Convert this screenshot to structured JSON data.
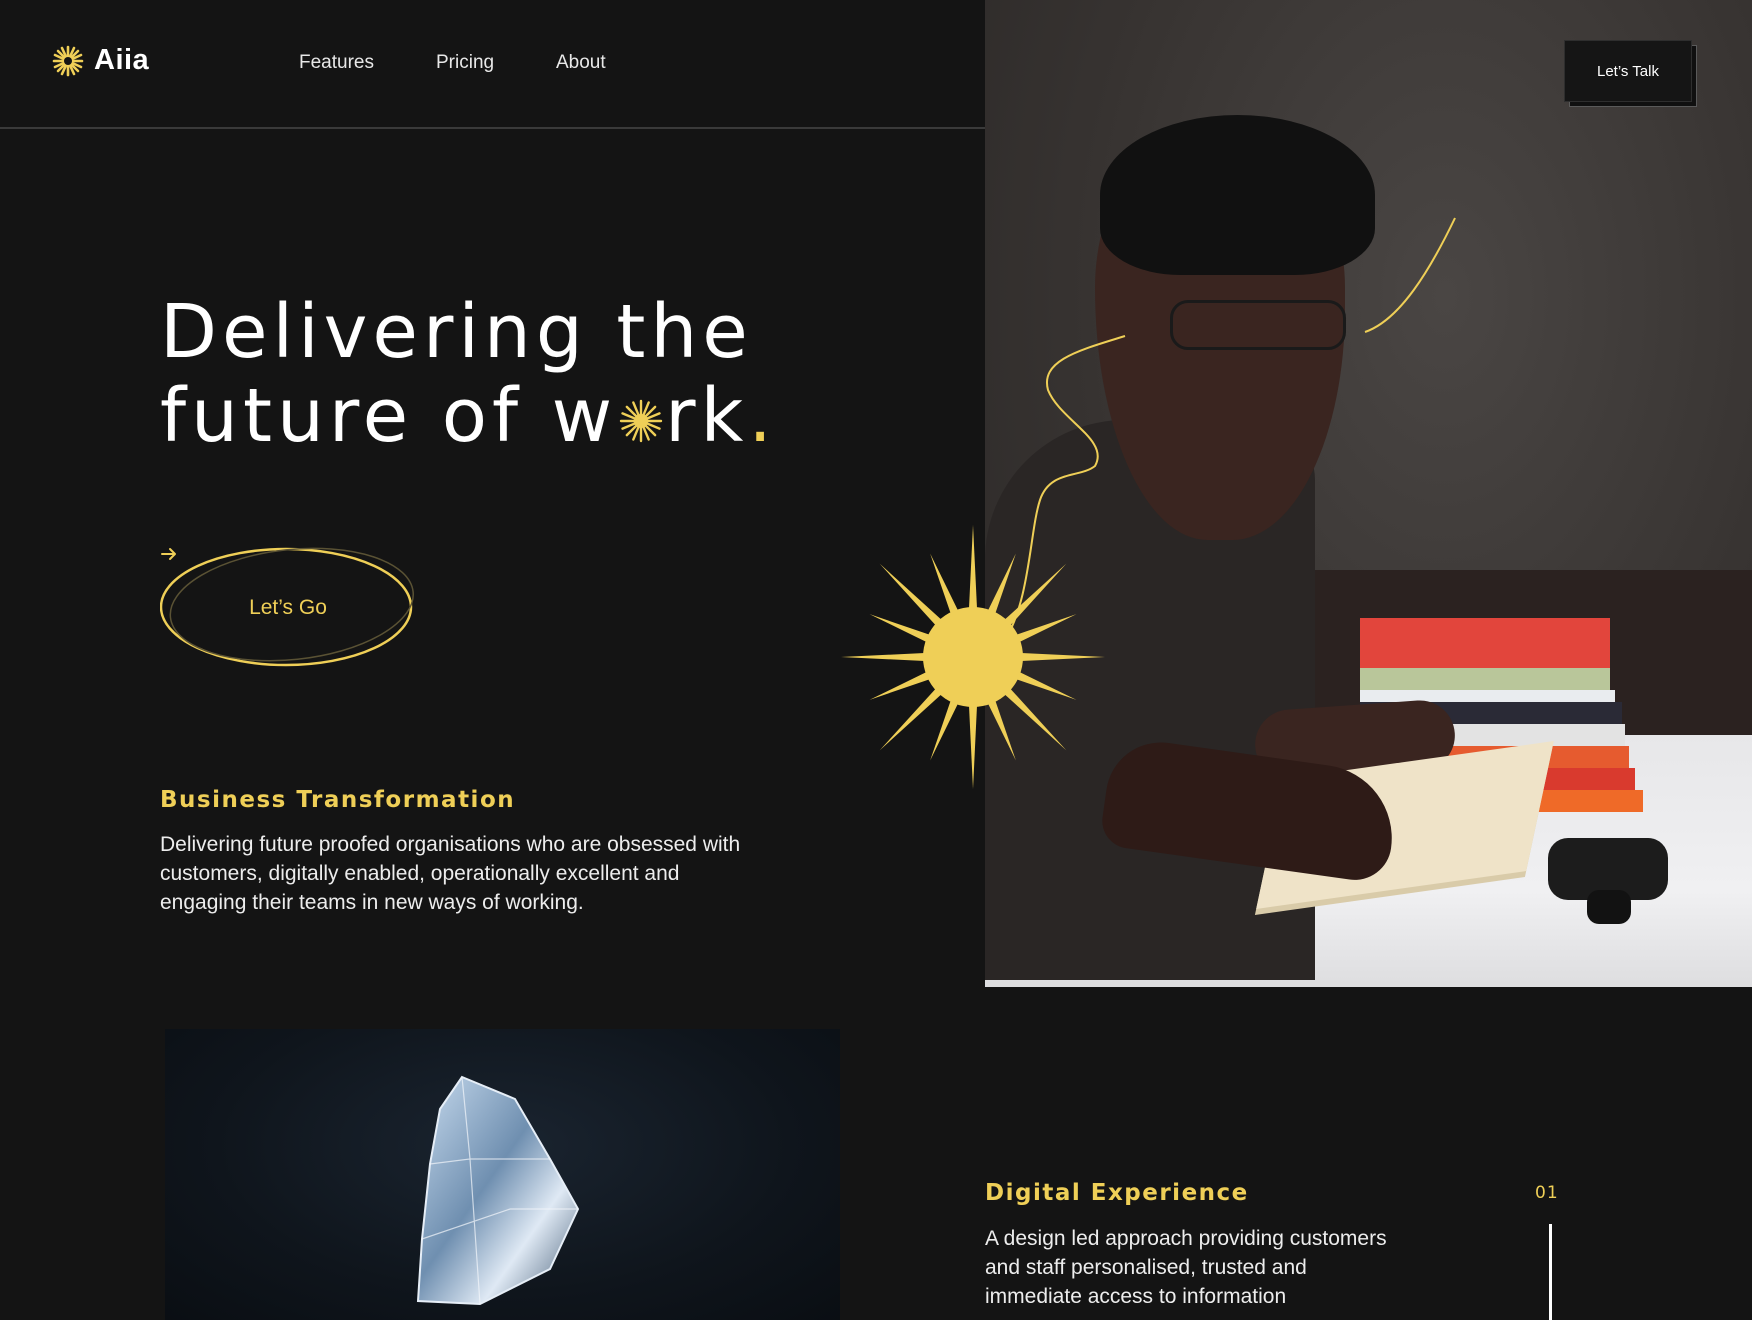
{
  "brand": {
    "name": "Aiia",
    "logo_icon": "sunburst-icon",
    "accent": "#efcf57"
  },
  "nav": {
    "items": [
      {
        "label": "Features"
      },
      {
        "label": "Pricing"
      },
      {
        "label": "About"
      }
    ]
  },
  "header": {
    "cta_label": "Let’s Talk"
  },
  "hero": {
    "line1": "Delivering the",
    "line2_prefix": "future of w",
    "line2_suffix": "rk",
    "line2_dot": ".",
    "button_label": "Let’s Go",
    "button_icon": "arrow-right-icon"
  },
  "sections": [
    {
      "title": "Business Transformation",
      "body": "Delivering future proofed organisations who are obsessed with customers, digitally enabled, operationally excellent and engaging their teams in new ways of working."
    },
    {
      "title": "Digital Experience",
      "body": "A design led approach providing customers and staff personalised, trusted and immediate access to information",
      "counter": "01"
    }
  ],
  "images": {
    "hero_photo": "person-reading-photo",
    "crystal_photo": "crystal-photo"
  }
}
